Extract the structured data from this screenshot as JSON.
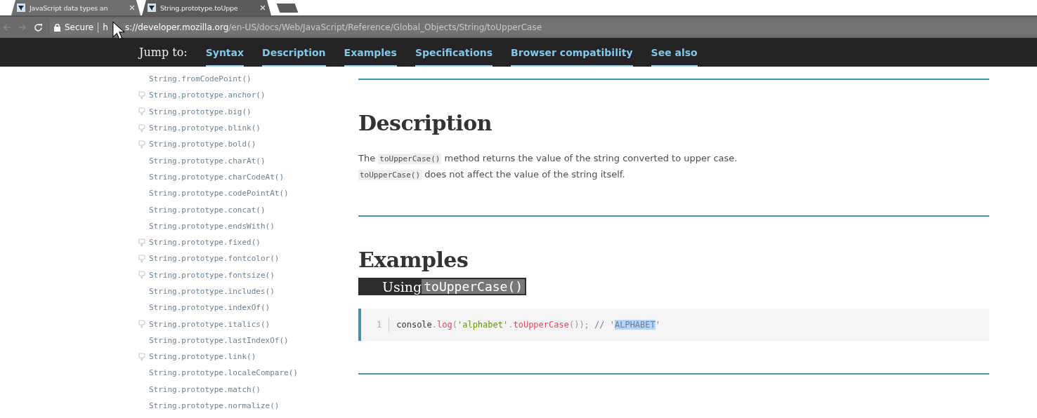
{
  "browser": {
    "tabs": [
      {
        "title": "JavaScript data types an",
        "selected": false
      },
      {
        "title": "String.prototype.toUppe",
        "selected": true
      }
    ],
    "security": "Secure",
    "url_scheme_visible": "h",
    "url_host": "s://developer.mozilla.org",
    "url_path": "/en-US/docs/Web/JavaScript/Reference/Global_Objects/String/toUpperCase"
  },
  "jump_bar": {
    "label": "Jump to:",
    "links": [
      "Syntax",
      "Description",
      "Examples",
      "Specifications",
      "Browser compatibility",
      "See also"
    ]
  },
  "sidebar": {
    "items": [
      {
        "label": "String.fromCodePoint()",
        "deprecated": false
      },
      {
        "label": "String.prototype.anchor()",
        "deprecated": true
      },
      {
        "label": "String.prototype.big()",
        "deprecated": true
      },
      {
        "label": "String.prototype.blink()",
        "deprecated": true
      },
      {
        "label": "String.prototype.bold()",
        "deprecated": true
      },
      {
        "label": "String.prototype.charAt()",
        "deprecated": false
      },
      {
        "label": "String.prototype.charCodeAt()",
        "deprecated": false
      },
      {
        "label": "String.prototype.codePointAt()",
        "deprecated": false
      },
      {
        "label": "String.prototype.concat()",
        "deprecated": false
      },
      {
        "label": "String.prototype.endsWith()",
        "deprecated": false
      },
      {
        "label": "String.prototype.fixed()",
        "deprecated": true
      },
      {
        "label": "String.prototype.fontcolor()",
        "deprecated": true
      },
      {
        "label": "String.prototype.fontsize()",
        "deprecated": true
      },
      {
        "label": "String.prototype.includes()",
        "deprecated": false
      },
      {
        "label": "String.prototype.indexOf()",
        "deprecated": false
      },
      {
        "label": "String.prototype.italics()",
        "deprecated": true
      },
      {
        "label": "String.prototype.lastIndexOf()",
        "deprecated": false
      },
      {
        "label": "String.prototype.link()",
        "deprecated": true
      },
      {
        "label": "String.prototype.localeCompare()",
        "deprecated": false
      },
      {
        "label": "String.prototype.match()",
        "deprecated": false
      },
      {
        "label": "String.prototype.normalize()",
        "deprecated": false
      }
    ]
  },
  "description": {
    "heading": "Description",
    "lines": [
      [
        {
          "kind": "text",
          "text": "The "
        },
        {
          "kind": "code",
          "text": "toUpperCase()"
        },
        {
          "kind": "text",
          "text": " method returns the value of the string converted to upper case."
        }
      ],
      [
        {
          "kind": "code",
          "text": "toUpperCase()"
        },
        {
          "kind": "text",
          "text": " does not affect the value of the string itself."
        }
      ]
    ]
  },
  "examples": {
    "heading": "Examples",
    "subheading": {
      "text": "Using ",
      "code": "toUpperCase()",
      "selected": true
    },
    "code": {
      "line_number": "1",
      "tokens": [
        {
          "kind": "plain",
          "text": "console",
          "selected": false
        },
        {
          "kind": "punct",
          "text": ".",
          "selected": false
        },
        {
          "kind": "func",
          "text": "log",
          "selected": false
        },
        {
          "kind": "punct",
          "text": "(",
          "selected": false
        },
        {
          "kind": "string",
          "text": "'alphabet'",
          "selected": false
        },
        {
          "kind": "punct",
          "text": ".",
          "selected": false
        },
        {
          "kind": "method",
          "text": "toUpperCase",
          "selected": false
        },
        {
          "kind": "punct",
          "text": "());",
          "selected": false
        },
        {
          "kind": "comment",
          "text": " // '",
          "selected": false
        },
        {
          "kind": "comment",
          "text": "ALPHABET",
          "selected": true
        },
        {
          "kind": "comment",
          "text": "'",
          "selected": false
        }
      ]
    }
  }
}
